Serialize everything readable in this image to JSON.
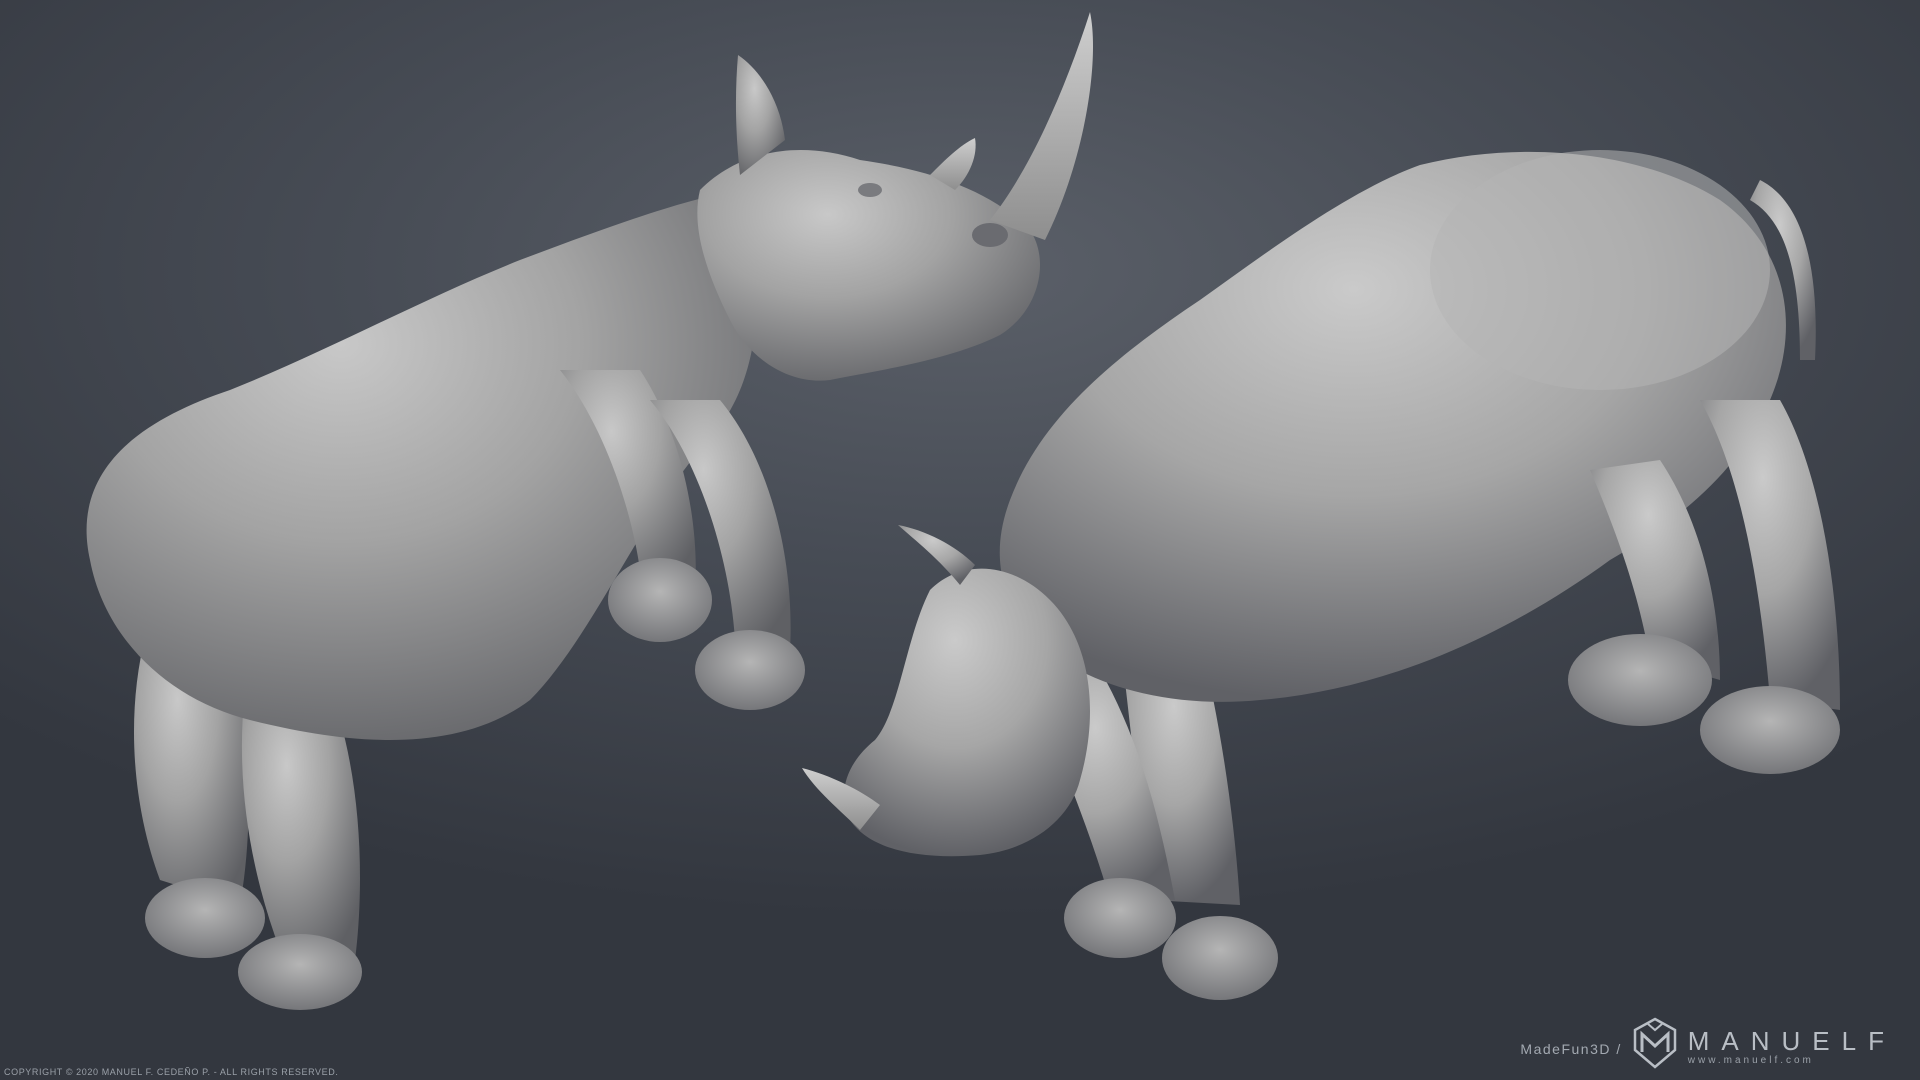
{
  "image": {
    "subject": "Two grey sculpted rhinoceros renders on a dark gradient backdrop",
    "background_colors": [
      "#5b6069",
      "#474c55",
      "#33373f"
    ],
    "clay_color": "#9a9a9a"
  },
  "footer": {
    "copyright": "COPYRIGHT © 2020 MANUEL F. CEDEÑO P. - ALL RIGHTS RESERVED.",
    "studio": "MadeFun3D /",
    "brand_name": "MANUELF",
    "brand_url": "www.manuelf.com",
    "logo_icon": "helmet-m-logo-icon"
  }
}
